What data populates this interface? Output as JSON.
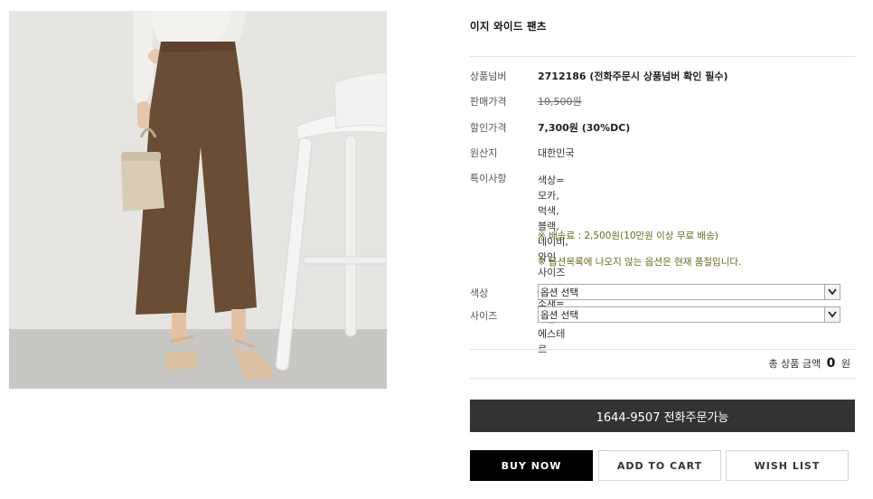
{
  "product": {
    "title": "이지 와이드 팬츠",
    "rows": {
      "code_label": "상품넘버",
      "code_value": "2712186 (전화주문시 상품넘버 확인 필수)",
      "price_label": "판매가격",
      "price_value": "10,500원",
      "sale_label": "할인가격",
      "sale_value": "7,300원 (30%DC)",
      "origin_label": "원산지",
      "origin_value": "대한민국",
      "special_label": "특이사항",
      "special_lines": [
        "색상=모카, 먹색, 블랙, 네이비, 와인",
        "사이즈=FREE",
        "소재=면폴리에스테르"
      ],
      "shipping_note": "※ 배송료 : 2,500원(10만원 이상 무료 배송)",
      "option_note": "※ 옵션목록에 나오지 않는 옵션은 현재 품절입니다."
    }
  },
  "options": {
    "color_label": "색상",
    "color_value": "옵션 선택",
    "size_label": "사이즈",
    "size_value": "옵션 선택"
  },
  "total": {
    "label": "총 상품 금액",
    "amount": "0",
    "unit": "원"
  },
  "buttons": {
    "phone_order": "1644-9507 전화주문가능",
    "buy_now": "BUY NOW",
    "add_to_cart": "ADD TO CART",
    "wish_list": "WISH LIST"
  },
  "colors": {
    "phone_bar": "#333333",
    "buy_now_bg": "#000000",
    "note_text": "#6b6b22"
  }
}
